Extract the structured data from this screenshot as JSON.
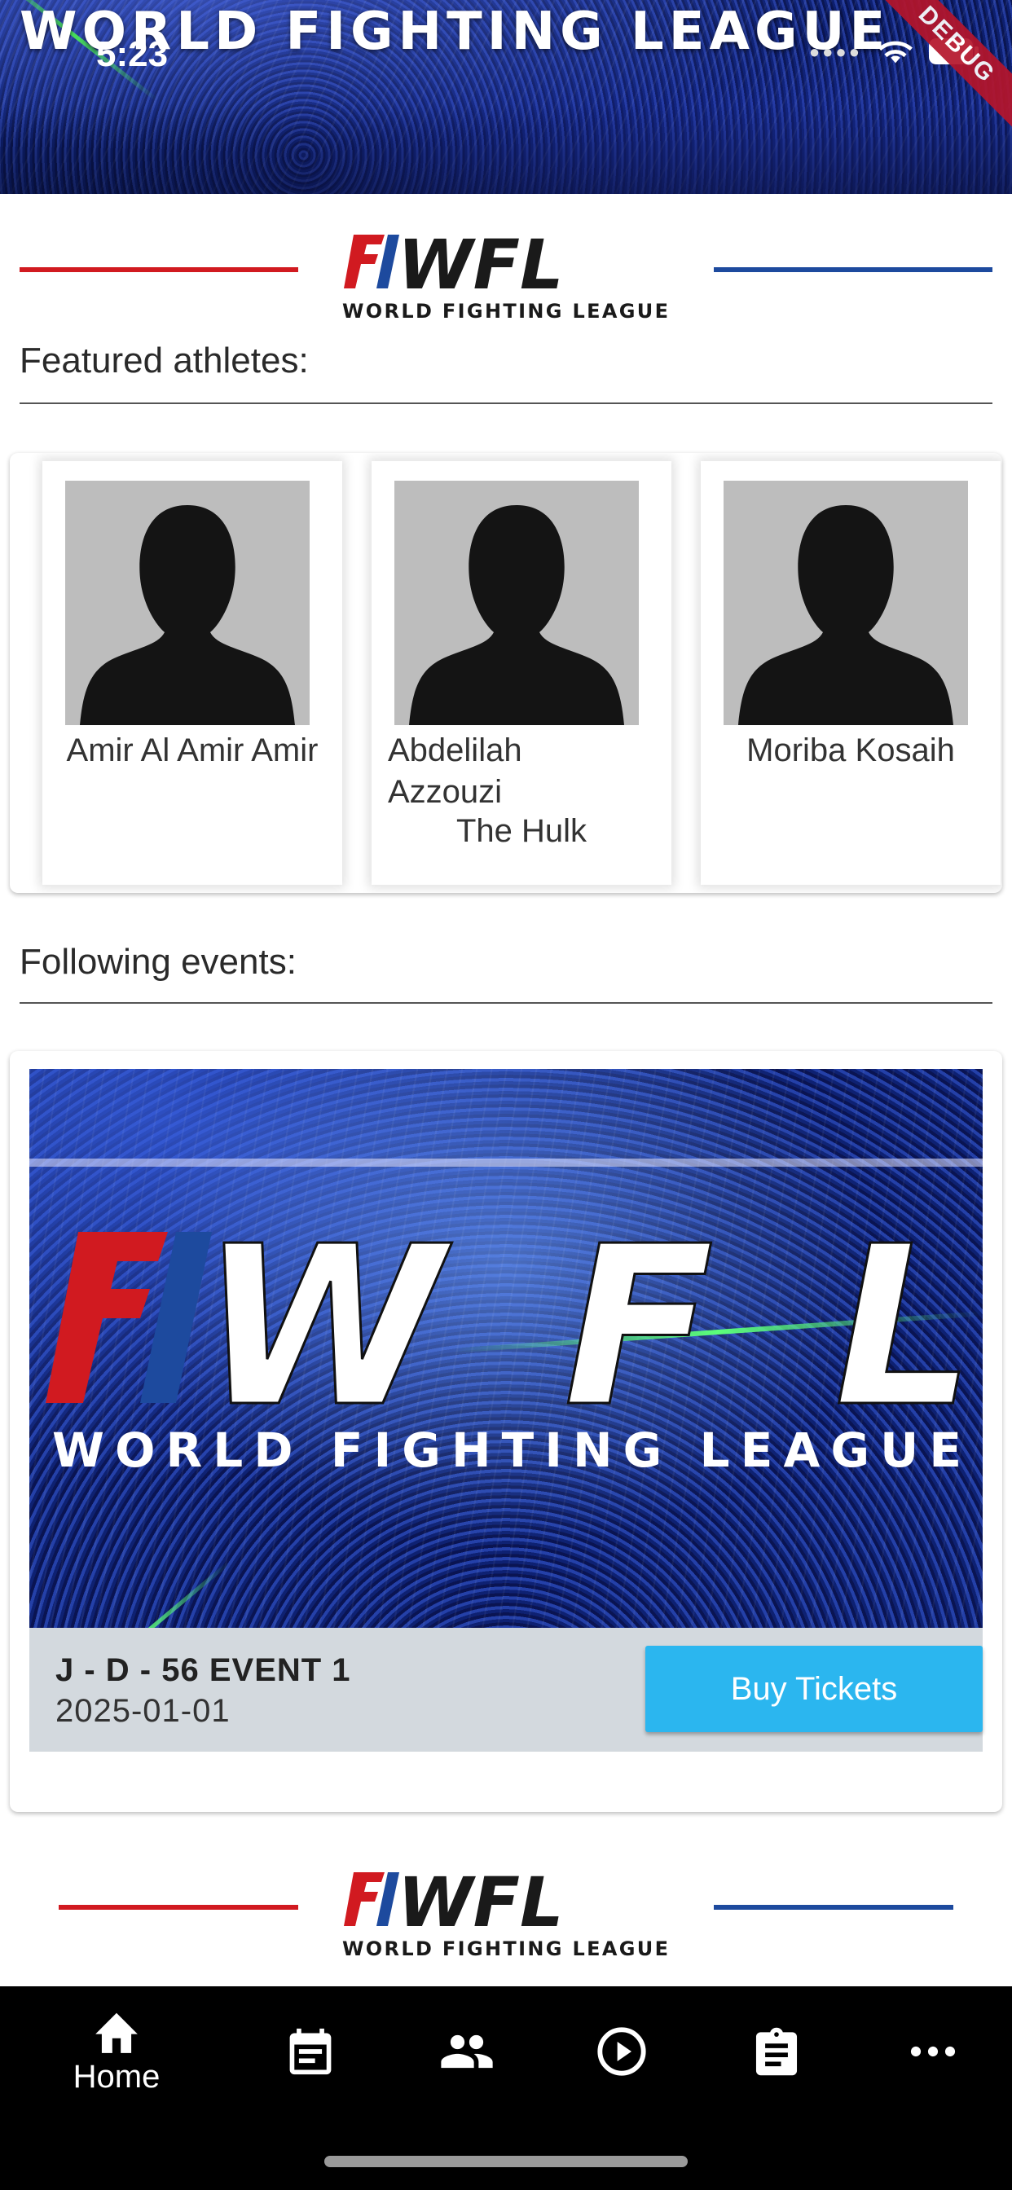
{
  "hero": {
    "title": "WORLD FIGHTING LEAGUE"
  },
  "status_bar": {
    "time": "5:23",
    "debug_label": "DEBUG"
  },
  "logo": {
    "monogram": "WFL",
    "tagline": "WORLD FIGHTING LEAGUE",
    "red": "#d11a20",
    "blue": "#1d4a9e"
  },
  "featured": {
    "heading": "Featured athletes:",
    "athletes": [
      {
        "name": "Amir Al Amir Amir",
        "nickname": ""
      },
      {
        "name": "Abdelilah Azzouzi",
        "nickname": "The Hulk"
      },
      {
        "name": "Moriba Kosaih",
        "nickname": ""
      }
    ]
  },
  "events": {
    "heading": "Following events:",
    "items": [
      {
        "banner_monogram": "WFL",
        "banner_tagline": "WORLD FIGHTING LEAGUE",
        "name": "J - D - 56 EVENT 1",
        "date": "2025-01-01",
        "cta": "Buy Tickets",
        "cta_color": "#2bb6ef"
      }
    ]
  },
  "bottom_nav": {
    "items": [
      {
        "label": "Home",
        "icon": "home-icon",
        "active": true
      },
      {
        "label": "",
        "icon": "calendar-icon",
        "active": false
      },
      {
        "label": "",
        "icon": "people-icon",
        "active": false
      },
      {
        "label": "",
        "icon": "play-icon",
        "active": false
      },
      {
        "label": "",
        "icon": "clipboard-icon",
        "active": false
      },
      {
        "label": "",
        "icon": "more-icon",
        "active": false
      }
    ]
  }
}
